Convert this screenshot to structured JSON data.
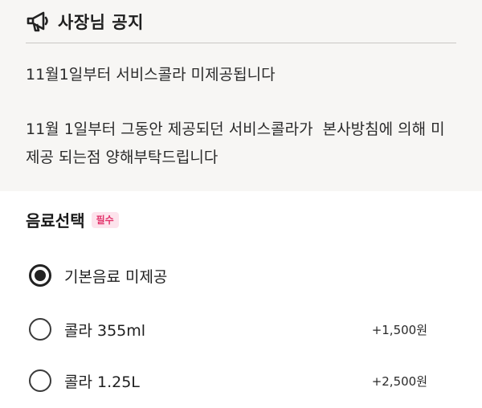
{
  "notice": {
    "icon": "megaphone-icon",
    "title": "사장님 공지",
    "headline": "11월1일부터 서비스콜라 미제공됩니다",
    "body": "11월 1일부터 그동안 제공되던 서비스콜라가  본사방침에 의해 미\n제공 되는점 양해부탁드립니다"
  },
  "drink_selection": {
    "title": "음료선택",
    "required_badge": "필수",
    "options": [
      {
        "label": "기본음료 미제공",
        "price": "",
        "selected": true
      },
      {
        "label": "콜라 355ml",
        "price": "+1,500원",
        "selected": false
      },
      {
        "label": "콜라 1.25L",
        "price": "+2,500원",
        "selected": false
      }
    ]
  },
  "colors": {
    "notice_background": "#f7f6f4",
    "badge_background": "#fde3ec",
    "badge_text": "#e2336b",
    "radio_selected": "#222222"
  }
}
